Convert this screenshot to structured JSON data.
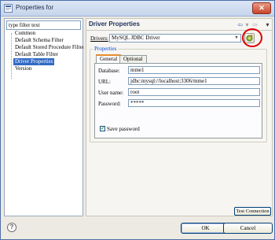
{
  "window": {
    "title": "Properties for",
    "close_glyph": "✕"
  },
  "filter": {
    "value": "type filter text"
  },
  "tree": {
    "items": [
      {
        "label": "Common",
        "selected": false
      },
      {
        "label": "Default Schema Filter",
        "selected": false
      },
      {
        "label": "Default Stored Procedure Filter",
        "selected": false
      },
      {
        "label": "Default Table Filter",
        "selected": false
      },
      {
        "label": "Driver Properties",
        "selected": true
      },
      {
        "label": "Version",
        "selected": false
      }
    ]
  },
  "page": {
    "title": "Driver Properties",
    "nav": {
      "back": "⇦",
      "forward": "⇨",
      "menu": "▾"
    }
  },
  "driver": {
    "label": "Drivers:",
    "value": "MySQL JDBC Driver",
    "arrow": "▼"
  },
  "properties": {
    "legend": "Properties",
    "tabs": [
      {
        "label": "General",
        "active": true
      },
      {
        "label": "Optional",
        "active": false
      }
    ],
    "fields": [
      {
        "label": "Database:",
        "value": "mme1"
      },
      {
        "label": "URL:",
        "value": "jdbc:mysql://localhost:3306/mme1"
      },
      {
        "label": "User name:",
        "value": "root"
      },
      {
        "label": "Password:",
        "value": "*****"
      }
    ],
    "save_password": {
      "label": "Save password",
      "checked": true,
      "mark": "✔"
    }
  },
  "buttons": {
    "test": "Test Connection",
    "ok": "OK",
    "cancel": "Cancel",
    "help": "?"
  },
  "colors": {
    "accent": "#316ac5",
    "highlight": "#e00000",
    "tab_active": "#e68b2c"
  }
}
